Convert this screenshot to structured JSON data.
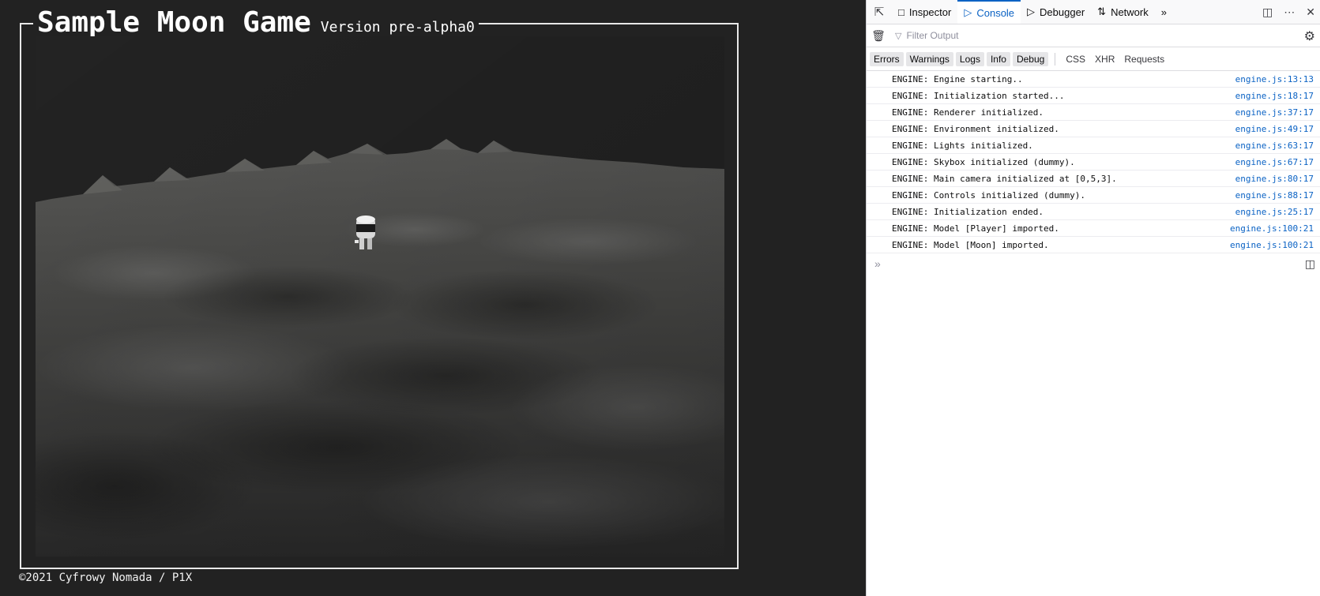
{
  "game": {
    "title": "Sample Moon Game",
    "version": "Version pre-alpha0",
    "footer": "©2021 Cyfrowy Nomada / P1X"
  },
  "devtools": {
    "tabs": [
      {
        "label": "Inspector",
        "icon": "inspector-icon"
      },
      {
        "label": "Console",
        "icon": "console-icon",
        "active": true
      },
      {
        "label": "Debugger",
        "icon": "debugger-icon"
      },
      {
        "label": "Network",
        "icon": "network-icon"
      }
    ],
    "filter_placeholder": "Filter Output",
    "levels": [
      "Errors",
      "Warnings",
      "Logs",
      "Info",
      "Debug"
    ],
    "net_filters": [
      "CSS",
      "XHR",
      "Requests"
    ],
    "messages": [
      {
        "text": "ENGINE: Engine starting..",
        "source": "engine.js:13:13"
      },
      {
        "text": "ENGINE: Initialization started...",
        "source": "engine.js:18:17"
      },
      {
        "text": "ENGINE: Renderer initialized.",
        "source": "engine.js:37:17"
      },
      {
        "text": "ENGINE: Environment initialized.",
        "source": "engine.js:49:17"
      },
      {
        "text": "ENGINE: Lights initialized.",
        "source": "engine.js:63:17"
      },
      {
        "text": "ENGINE: Skybox initialized (dummy).",
        "source": "engine.js:67:17"
      },
      {
        "text": "ENGINE: Main camera initialized at [0,5,3].",
        "source": "engine.js:80:17"
      },
      {
        "text": "ENGINE: Controls initialized (dummy).",
        "source": "engine.js:88:17"
      },
      {
        "text": "ENGINE: Initialization ended.",
        "source": "engine.js:25:17"
      },
      {
        "text": "ENGINE: Model [Player] imported.",
        "source": "engine.js:100:21"
      },
      {
        "text": "ENGINE: Model [Moon] imported.",
        "source": "engine.js:100:21"
      }
    ],
    "accent_color": "#0a62c4"
  }
}
